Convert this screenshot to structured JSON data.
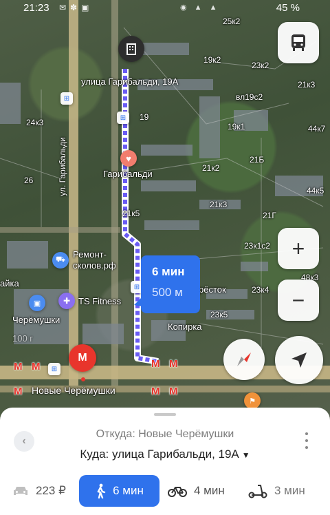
{
  "status_bar": {
    "time": "21:23",
    "battery": "45 %"
  },
  "map": {
    "street_labels": [
      "25к2",
      "19к2",
      "23к2",
      "21к3",
      "вл19с2",
      "24к3",
      "19",
      "19к1",
      "44к7",
      "21к2",
      "21Б",
      "26",
      "44к5",
      "21к3",
      "21к5",
      "21Г",
      "23к1с2",
      "48к3",
      "23к4",
      "23к5"
    ],
    "vertical_street": "ул. Гарибальди",
    "destination_label": "улица Гарибальди, 19А",
    "pois": {
      "garibaldi": "Гарибальди",
      "remont": "Ремонт-\nсколов.рф",
      "ts_fitness": "TS Fitness",
      "cheryomushki": "Черёмушки",
      "perekrestok": "рёсток",
      "kopirka": "Копирка",
      "vaika": "айка",
      "hundred": "100 г"
    },
    "metro_station": "Новые Черёмушки",
    "route_bubble": {
      "time": "6 мин",
      "distance": "500 м"
    }
  },
  "sheet": {
    "from": "Откуда: Новые Черёмушки",
    "to": "Куда: улица Гарибальди, 19А",
    "modes": [
      {
        "name": "car",
        "value": "223 ₽"
      },
      {
        "name": "walk",
        "value": "6 мин",
        "selected": true
      },
      {
        "name": "bike",
        "value": "4 мин"
      },
      {
        "name": "scooter",
        "value": "3 мин"
      }
    ]
  },
  "colors": {
    "accent": "#2f72ec",
    "metro": "#e8352c",
    "route": "#6a5cf5"
  }
}
